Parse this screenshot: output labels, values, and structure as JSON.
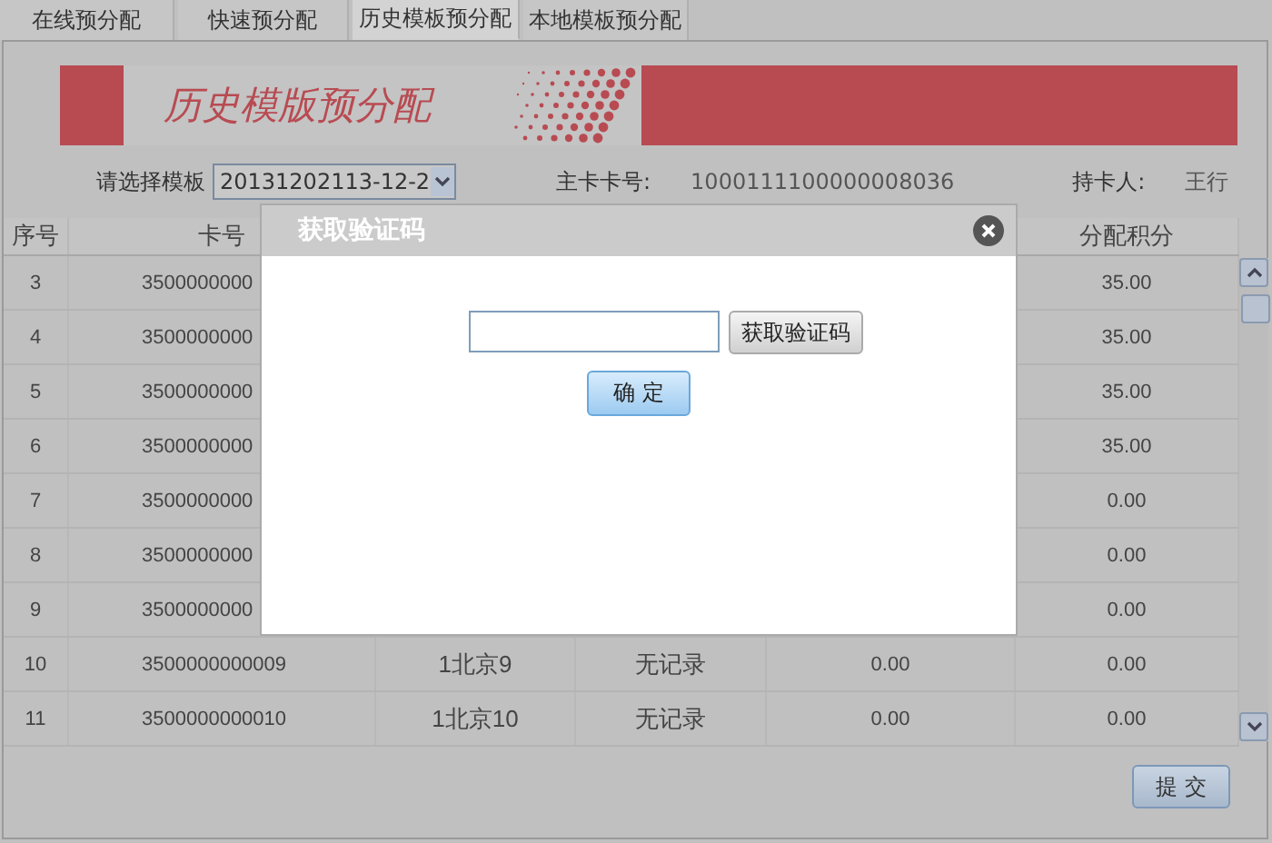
{
  "tabs": [
    {
      "label": "在线预分配",
      "selected": false
    },
    {
      "label": "快速预分配",
      "selected": false
    },
    {
      "label": "历史模板预分配",
      "selected": true
    },
    {
      "label": "本地模板预分配",
      "selected": false
    }
  ],
  "banner": {
    "title": "历史模版预分配"
  },
  "form": {
    "template_label": "请选择模板",
    "template_value": "20131202113-12-2",
    "card_label": "主卡卡号:",
    "card_value": "1000111100000008036",
    "holder_label": "持卡人:",
    "holder_value": "王行"
  },
  "table": {
    "columns": [
      "序号",
      "卡号",
      "",
      "",
      "",
      "分配积分"
    ],
    "rows": [
      {
        "cells": [
          "3",
          "3500000000",
          "",
          "",
          "",
          "35.00"
        ]
      },
      {
        "cells": [
          "4",
          "3500000000",
          "",
          "",
          "",
          "35.00"
        ]
      },
      {
        "cells": [
          "5",
          "3500000000",
          "",
          "",
          "",
          "35.00"
        ]
      },
      {
        "cells": [
          "6",
          "3500000000",
          "",
          "",
          "",
          "35.00"
        ]
      },
      {
        "cells": [
          "7",
          "3500000000",
          "",
          "",
          "",
          "0.00"
        ]
      },
      {
        "cells": [
          "8",
          "3500000000",
          "",
          "",
          "",
          "0.00"
        ]
      },
      {
        "cells": [
          "9",
          "3500000000",
          "",
          "",
          "",
          "0.00"
        ]
      },
      {
        "cells": [
          "10",
          "3500000000009",
          "1北京9",
          "无记录",
          "0.00",
          "0.00"
        ]
      },
      {
        "cells": [
          "11",
          "3500000000010",
          "1北京10",
          "无记录",
          "0.00",
          "0.00"
        ]
      }
    ]
  },
  "submit_button": "提 交",
  "dialog": {
    "title": "获取验证码",
    "code_button": "获取验证码",
    "confirm_button": "确 定"
  }
}
